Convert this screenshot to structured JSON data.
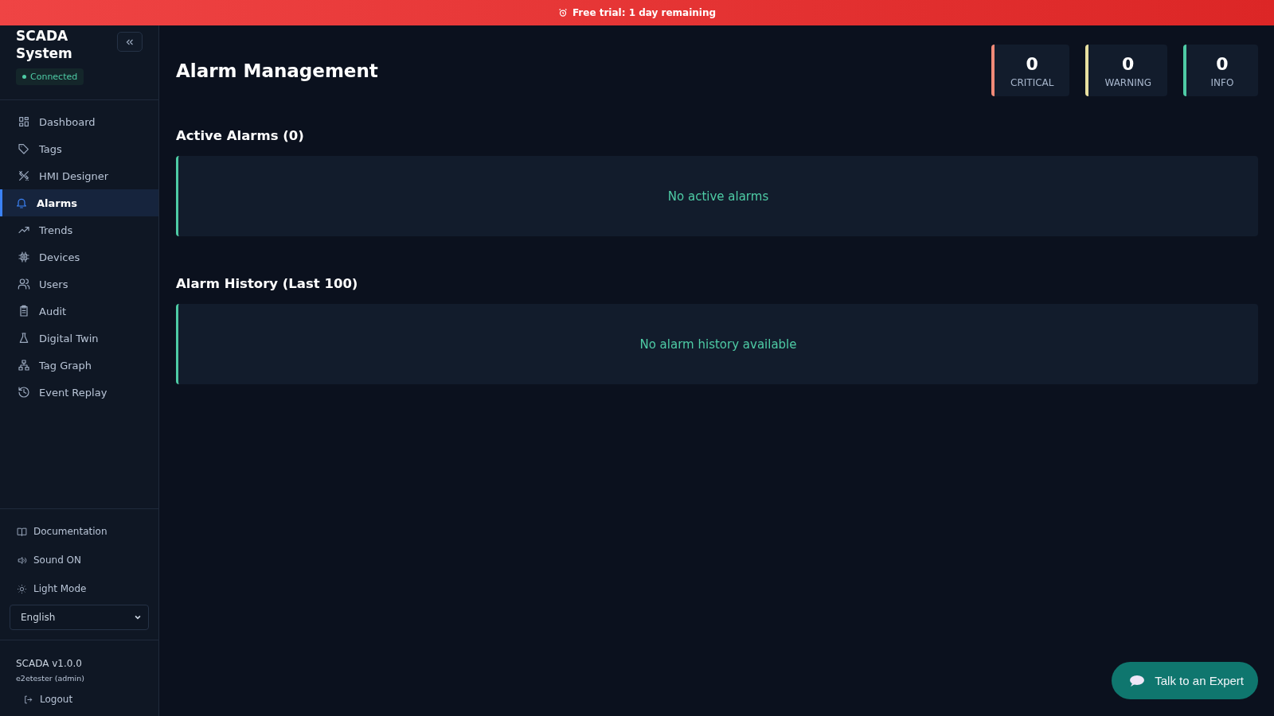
{
  "banner": {
    "text": "Free trial: 1 day remaining"
  },
  "sidebar": {
    "title": "SCADA System",
    "status": "Connected",
    "items": [
      {
        "label": "Dashboard",
        "selected": false
      },
      {
        "label": "Tags",
        "selected": false
      },
      {
        "label": "HMI Designer",
        "selected": false
      },
      {
        "label": "Alarms",
        "selected": true
      },
      {
        "label": "Trends",
        "selected": false
      },
      {
        "label": "Devices",
        "selected": false
      },
      {
        "label": "Users",
        "selected": false
      },
      {
        "label": "Audit",
        "selected": false
      },
      {
        "label": "Digital Twin",
        "selected": false
      },
      {
        "label": "Tag Graph",
        "selected": false
      },
      {
        "label": "Event Replay",
        "selected": false
      }
    ],
    "footer_links": [
      "Documentation",
      "Sound ON",
      "Light Mode"
    ],
    "language": "English",
    "version": "SCADA v1.0.0",
    "user": "e2etester (admin)",
    "logout": "Logout"
  },
  "page": {
    "title": "Alarm Management",
    "stats": [
      {
        "value": "0",
        "label": "CRITICAL",
        "color": "#f08a78"
      },
      {
        "value": "0",
        "label": "WARNING",
        "color": "#e8e0a0"
      },
      {
        "value": "0",
        "label": "INFO",
        "color": "#4ecba5"
      }
    ],
    "sections": [
      {
        "title": "Active Alarms (0)",
        "empty": "No active alarms"
      },
      {
        "title": "Alarm History (Last 100)",
        "empty": "No alarm history available"
      }
    ]
  },
  "chat_button": "Talk to an Expert"
}
